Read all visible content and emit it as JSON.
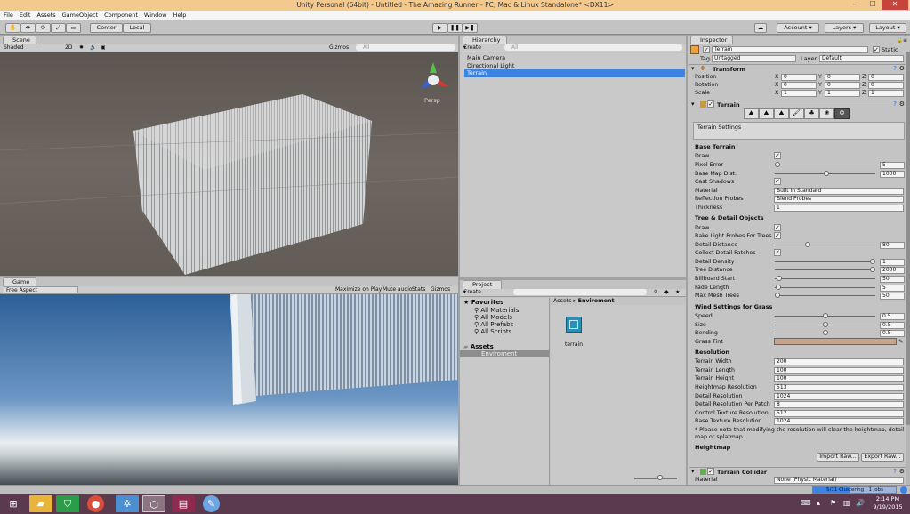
{
  "window": {
    "title": "Unity Personal (64bit) - Untitled - The Amazing Runner - PC, Mac & Linux Standalone* <DX11>"
  },
  "menu": [
    "File",
    "Edit",
    "Assets",
    "GameObject",
    "Component",
    "Window",
    "Help"
  ],
  "toolbar": {
    "center": "Center",
    "local": "Local",
    "account": "Account",
    "layers": "Layers",
    "layout": "Layout"
  },
  "scene": {
    "tab": "Scene",
    "shading": "Shaded",
    "mode2d": "2D",
    "gizmos": "Gizmos",
    "search": "All",
    "persp": "Persp"
  },
  "game": {
    "tab": "Game",
    "aspect": "Free Aspect",
    "maximize": "Maximize on Play",
    "mute": "Mute audio",
    "stats": "Stats",
    "gizmos": "Gizmos"
  },
  "hierarchy": {
    "tab": "Hierarchy",
    "create": "Create",
    "search": "All",
    "items": [
      "Main Camera",
      "Directional Light",
      "Terrain"
    ],
    "selected": "Terrain"
  },
  "project": {
    "tab": "Project",
    "create": "Create",
    "favorites_label": "Favorites",
    "favorites": [
      "All Materials",
      "All Models",
      "All Prefabs",
      "All Scripts"
    ],
    "assets_label": "Assets",
    "assets_children": [
      "Enviroment"
    ],
    "breadcrumb_root": "Assets",
    "breadcrumb_folder": "Enviroment",
    "files": [
      "terrain"
    ]
  },
  "inspector": {
    "tab": "Inspector",
    "object_name": "Terrain",
    "static": "Static",
    "tag_label": "Tag",
    "tag": "Untagged",
    "layer_label": "Layer",
    "layer": "Default",
    "transform": {
      "header": "Transform",
      "position_label": "Position",
      "rotation_label": "Rotation",
      "scale_label": "Scale",
      "position": [
        "0",
        "0",
        "0"
      ],
      "rotation": [
        "0",
        "0",
        "0"
      ],
      "scale": [
        "1",
        "1",
        "1"
      ],
      "x": "X",
      "y": "Y",
      "z": "Z"
    },
    "terrain_header": "Terrain",
    "settings_box": "Terrain Settings",
    "base_terrain": {
      "header": "Base Terrain",
      "draw": "Draw",
      "pixel_error": "Pixel Error",
      "pixel_error_val": "5",
      "base_map_dist": "Base Map Dist.",
      "base_map_dist_val": "1000",
      "cast_shadows": "Cast Shadows",
      "material": "Material",
      "material_val": "Built In Standard",
      "reflection_probes": "Reflection Probes",
      "reflection_probes_val": "Blend Probes",
      "thickness": "Thickness",
      "thickness_val": "1"
    },
    "tree_detail": {
      "header": "Tree & Detail Objects",
      "draw": "Draw",
      "bake_light": "Bake Light Probes For Trees",
      "detail_distance": "Detail Distance",
      "detail_distance_val": "80",
      "collect_patches": "Collect Detail Patches",
      "detail_density": "Detail Density",
      "detail_density_val": "1",
      "tree_distance": "Tree Distance",
      "tree_distance_val": "2000",
      "billboard_start": "Billboard Start",
      "billboard_start_val": "50",
      "fade_length": "Fade Length",
      "fade_length_val": "5",
      "max_mesh_trees": "Max Mesh Trees",
      "max_mesh_trees_val": "50"
    },
    "wind": {
      "header": "Wind Settings for Grass",
      "speed": "Speed",
      "speed_val": "0.5",
      "size": "Size",
      "size_val": "0.5",
      "bending": "Bending",
      "bending_val": "0.5",
      "grass_tint": "Grass Tint",
      "grass_tint_color": "#c8a48c"
    },
    "resolution": {
      "header": "Resolution",
      "width": "Terrain Width",
      "width_val": "200",
      "length": "Terrain Length",
      "length_val": "100",
      "height": "Terrain Height",
      "height_val": "100",
      "heightmap": "Heightmap Resolution",
      "heightmap_val": "513",
      "detail": "Detail Resolution",
      "detail_val": "1024",
      "detail_patch": "Detail Resolution Per Patch",
      "detail_patch_val": "8",
      "control_tex": "Control Texture Resolution",
      "control_tex_val": "512",
      "base_tex": "Base Texture Resolution",
      "base_tex_val": "1024",
      "note": "* Please note that modifying the resolution will clear the heightmap, detail map or splatmap."
    },
    "heightmap": {
      "header": "Heightmap",
      "import": "Import Raw...",
      "export": "Export Raw..."
    },
    "collider": {
      "header": "Terrain Collider",
      "material_label": "Material",
      "material_val": "None (Physic Material)"
    }
  },
  "status": {
    "progress": "5/11 Clustering | 1 jobs",
    "progress_fraction": 0.45
  },
  "taskbar": {
    "time": "2:14 PM",
    "date": "9/19/2015"
  },
  "colors": {
    "selection": "#3d83e3",
    "titlebar": "#f3c98e",
    "taskbar": "#5c3a4e"
  }
}
